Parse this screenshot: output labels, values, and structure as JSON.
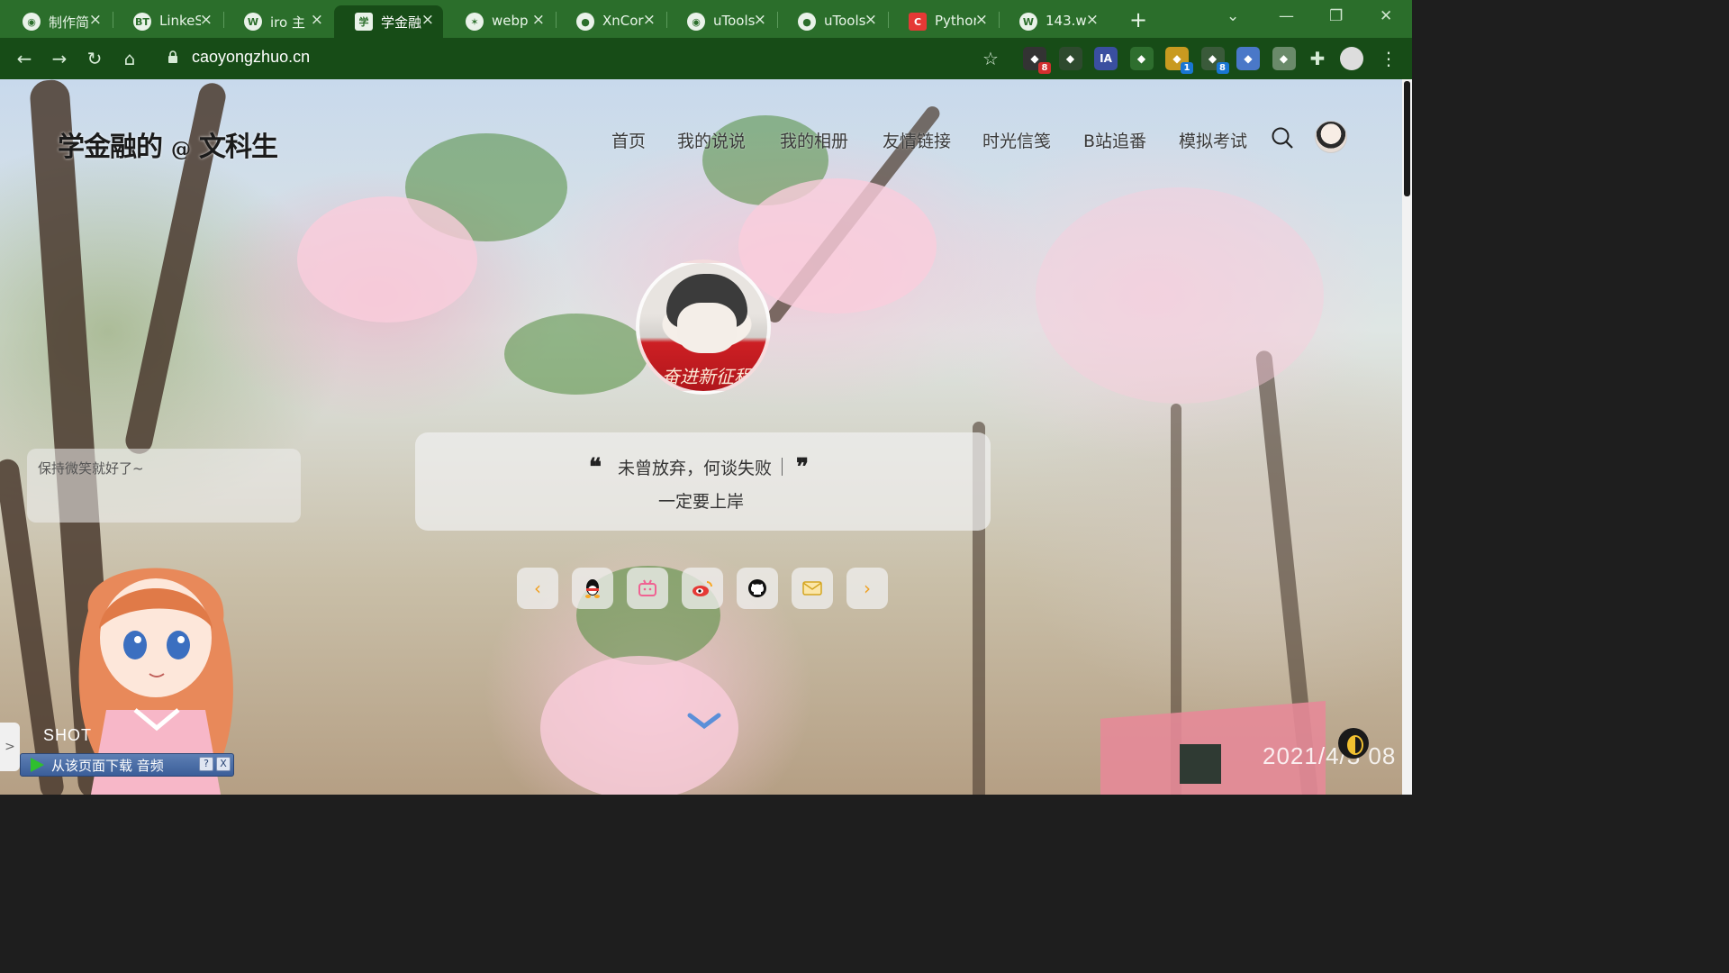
{
  "browser": {
    "tabs": [
      {
        "title": "制作简",
        "favicon": "globe-dark"
      },
      {
        "title": "LinkeS",
        "favicon": "BT"
      },
      {
        "title": "iro 主",
        "favicon": "wordpress"
      },
      {
        "title": "学金融",
        "favicon": "site"
      },
      {
        "title": "webp",
        "favicon": "webp"
      },
      {
        "title": "XnCor",
        "favicon": "xnconvert"
      },
      {
        "title": "uTools",
        "favicon": "globe"
      },
      {
        "title": "uTools",
        "favicon": "github"
      },
      {
        "title": "Pythor",
        "favicon": "C"
      },
      {
        "title": "143.w",
        "favicon": "wordpress"
      }
    ],
    "active_tab_index": 3,
    "url": "caoyongzhuo.cn",
    "extensions": [
      {
        "name": "ext-1",
        "badge": "8",
        "color": "#333333",
        "badge_color": "#d32f2f"
      },
      {
        "name": "ext-2",
        "badge": "",
        "color": "#2e4a2e"
      },
      {
        "name": "IA",
        "badge": "",
        "color": "#3a4fa0"
      },
      {
        "name": "ext-4",
        "badge": "",
        "color": "#2e6e2e"
      },
      {
        "name": "ext-5",
        "badge": "1",
        "color": "#c89a20",
        "badge_color": "#1976d2"
      },
      {
        "name": "ext-6",
        "badge": "8",
        "color": "#3a5a3a",
        "badge_color": "#1976d2"
      },
      {
        "name": "ext-7",
        "badge": "",
        "color": "#4a78c8"
      },
      {
        "name": "ext-8",
        "badge": "",
        "color": "#6a8a6a"
      }
    ]
  },
  "site": {
    "logo_main": "学金融的",
    "logo_at": "@",
    "logo_sub": "文科生",
    "nav": [
      "首页",
      "我的说说",
      "我的相册",
      "友情链接",
      "时光信笺",
      "B站追番",
      "模拟考试"
    ],
    "avatar_banner": "奋进新征程",
    "motto_line1": "未曾放弃，何谈失败",
    "motto_line2": "一定要上岸",
    "tooltip": "保持微笑就好了~",
    "social_icons": [
      "chevron-left-icon",
      "qq-icon",
      "bilibili-icon",
      "weibo-icon",
      "github-icon",
      "mail-icon",
      "chevron-right-icon"
    ],
    "shot_label": "SHOT",
    "download_bar": "从该页面下载 音频",
    "download_help": "?",
    "download_close": "X",
    "left_tab": ">",
    "clock": "2021/4/3 08"
  },
  "colors": {
    "tabbar": "#2b6e2b",
    "toolbar": "#174c17",
    "accent_orange": "#f0a020"
  }
}
